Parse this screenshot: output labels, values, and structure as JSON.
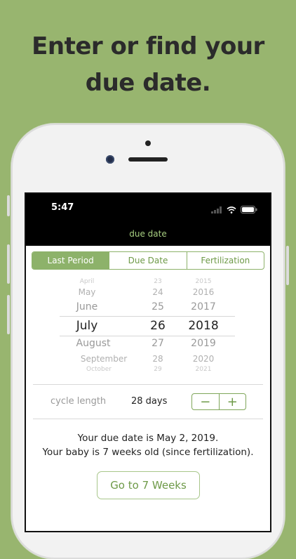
{
  "promo": {
    "headline_line1": "Enter or find your",
    "headline_line2": "due date."
  },
  "status_bar": {
    "time": "5:47",
    "icons": [
      "signal-icon",
      "wifi-icon",
      "battery-icon"
    ]
  },
  "screen": {
    "title": "due date"
  },
  "tabs": [
    {
      "label": "Last Period",
      "active": true
    },
    {
      "label": "Due Date",
      "active": false
    },
    {
      "label": "Fertilization",
      "active": false
    }
  ],
  "picker": {
    "months": [
      "April",
      "May",
      "June",
      "July",
      "August",
      "September",
      "October"
    ],
    "days": [
      "23",
      "24",
      "25",
      "26",
      "27",
      "28",
      "29"
    ],
    "years": [
      "2015",
      "2016",
      "2017",
      "2018",
      "2019",
      "2020",
      "2021"
    ],
    "selected": {
      "month": "July",
      "day": "26",
      "year": "2018"
    }
  },
  "cycle": {
    "label": "cycle length",
    "value": "28 days",
    "decrement_label": "−",
    "increment_label": "+"
  },
  "result": {
    "due_date_text": "Your due date is May 2, 2019.",
    "age_text": "Your baby is 7 weeks old (since fertilization)."
  },
  "action": {
    "label": "Go to 7 Weeks"
  },
  "colors": {
    "background": "#98b56f",
    "accent": "#8db26a",
    "title_green": "#a8d082"
  }
}
